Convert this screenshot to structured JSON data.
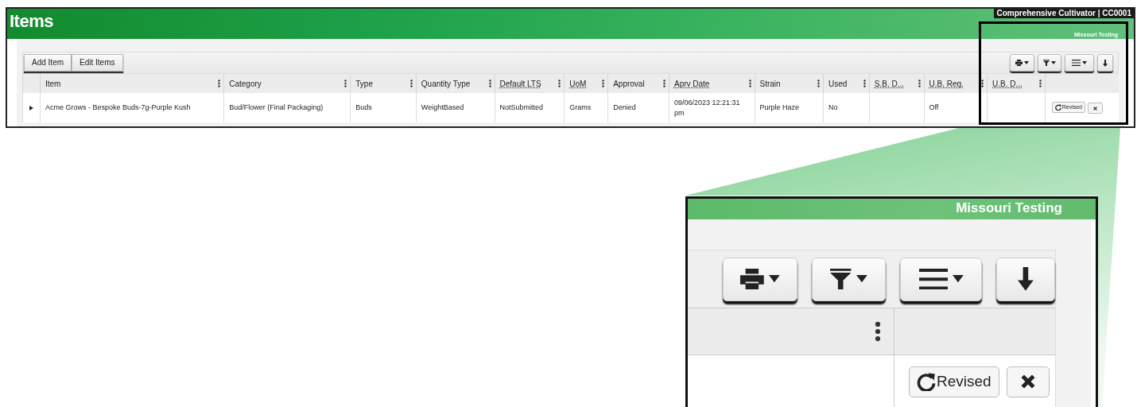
{
  "header": {
    "title": "Items",
    "account": "Comprehensive Cultivator | CC0001",
    "facility": "Missouri Testing"
  },
  "toolbar": {
    "buttons": [
      "Add Item",
      "Edit Items"
    ],
    "tools": [
      {
        "kind": "print"
      },
      {
        "kind": "filter"
      },
      {
        "kind": "columns"
      },
      {
        "kind": "download"
      }
    ]
  },
  "table": {
    "columns": [
      {
        "label": "Item",
        "abbr": false
      },
      {
        "label": "Category",
        "abbr": false
      },
      {
        "label": "Type",
        "abbr": false
      },
      {
        "label": "Quantity Type",
        "abbr": false
      },
      {
        "label": "Default LTS",
        "abbr": true
      },
      {
        "label": "UoM",
        "abbr": true
      },
      {
        "label": "Approval",
        "abbr": false
      },
      {
        "label": "Aprv Date",
        "abbr": true
      },
      {
        "label": "Strain",
        "abbr": false
      },
      {
        "label": "Used",
        "abbr": false
      },
      {
        "label": "S.B. D...",
        "abbr": true
      },
      {
        "label": "U.B. Req.",
        "abbr": true
      },
      {
        "label": "U.B. D...",
        "abbr": true
      }
    ],
    "rows": [
      {
        "expanded": false,
        "cells": [
          "Acme Grows - Bespoke Buds-7g-Purple Kush",
          "Bud/Flower (Final Packaging)",
          "Buds",
          "WeightBased",
          "NotSubmitted",
          "Grams",
          "Denied",
          "09/06/2023 12:21:31 pm",
          "Purple Haze",
          "No",
          "",
          "Off",
          ""
        ],
        "revise": "Revised"
      }
    ]
  },
  "callout": {
    "facility": "Missouri Testing",
    "tools": [
      {
        "kind": "print"
      },
      {
        "kind": "filter"
      },
      {
        "kind": "columns"
      },
      {
        "kind": "download"
      }
    ],
    "revise": "Revised"
  }
}
